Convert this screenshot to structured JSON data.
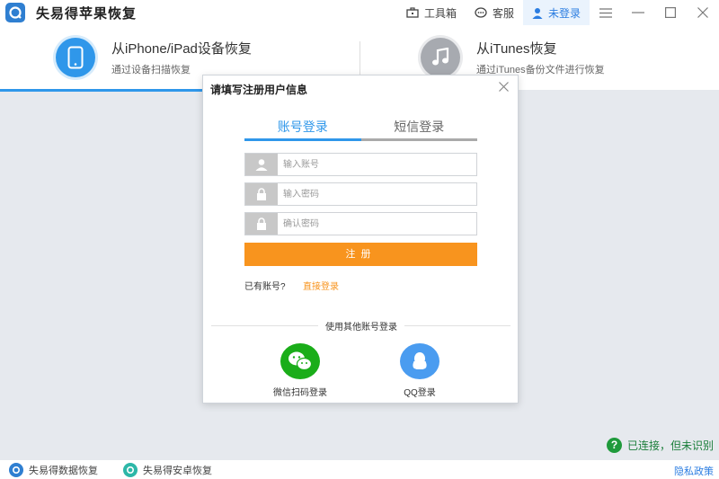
{
  "app": {
    "title": "失易得苹果恢复"
  },
  "titlebar": {
    "toolbox_label": "工具箱",
    "service_label": "客服",
    "login_label": "未登录"
  },
  "modes": [
    {
      "title": "从iPhone/iPad设备恢复",
      "subtitle": "通过设备扫描恢复",
      "icon": "phone-icon"
    },
    {
      "title": "从iTunes恢复",
      "subtitle": "通过iTunes备份文件进行恢复",
      "icon": "music-note-icon"
    }
  ],
  "dialog": {
    "title": "请填写注册用户信息",
    "tabs": [
      {
        "label": "账号登录",
        "active": true
      },
      {
        "label": "短信登录",
        "active": false
      }
    ],
    "fields": {
      "account_placeholder": "输入账号",
      "password_placeholder": "输入密码",
      "confirm_placeholder": "确认密码"
    },
    "register_label": "注册",
    "have_account_text": "已有账号?",
    "direct_login_link": "直接登录",
    "other_login_label": "使用其他账号登录",
    "wechat_label": "微信扫码登录",
    "qq_label": "QQ登录"
  },
  "status": {
    "connection_text": "已连接，但未识别"
  },
  "bottom": {
    "data_recovery_label": "失易得数据恢复",
    "android_recovery_label": "失易得安卓恢复",
    "privacy_label": "隐私政策"
  },
  "colors": {
    "accent_blue": "#2f97ea",
    "register_orange": "#f8941e",
    "wechat_green": "#1aad19",
    "qq_blue": "#4a9cf0",
    "status_green": "#1f9a3b"
  }
}
